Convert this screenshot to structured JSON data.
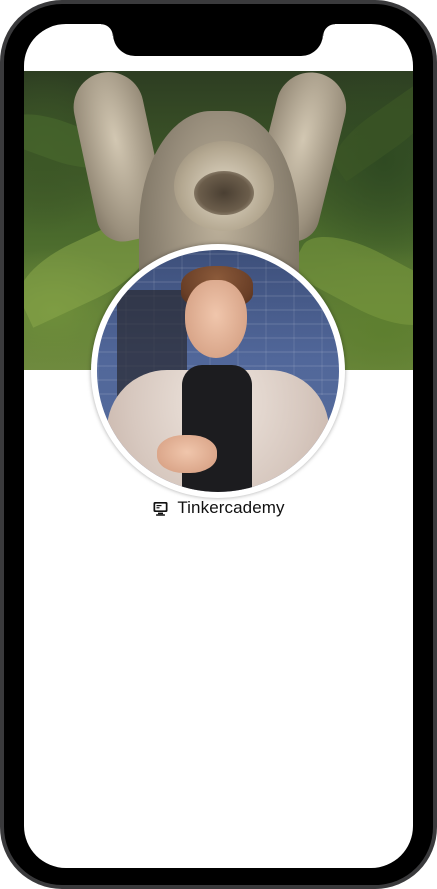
{
  "profile": {
    "name": "Tinkercademy",
    "name_icon": "computer-icon",
    "cover_image": "sloth-photo",
    "avatar_image": "person-photo"
  },
  "colors": {
    "text": "#111111",
    "background": "#ffffff",
    "device_frame": "#3a3a3c"
  }
}
